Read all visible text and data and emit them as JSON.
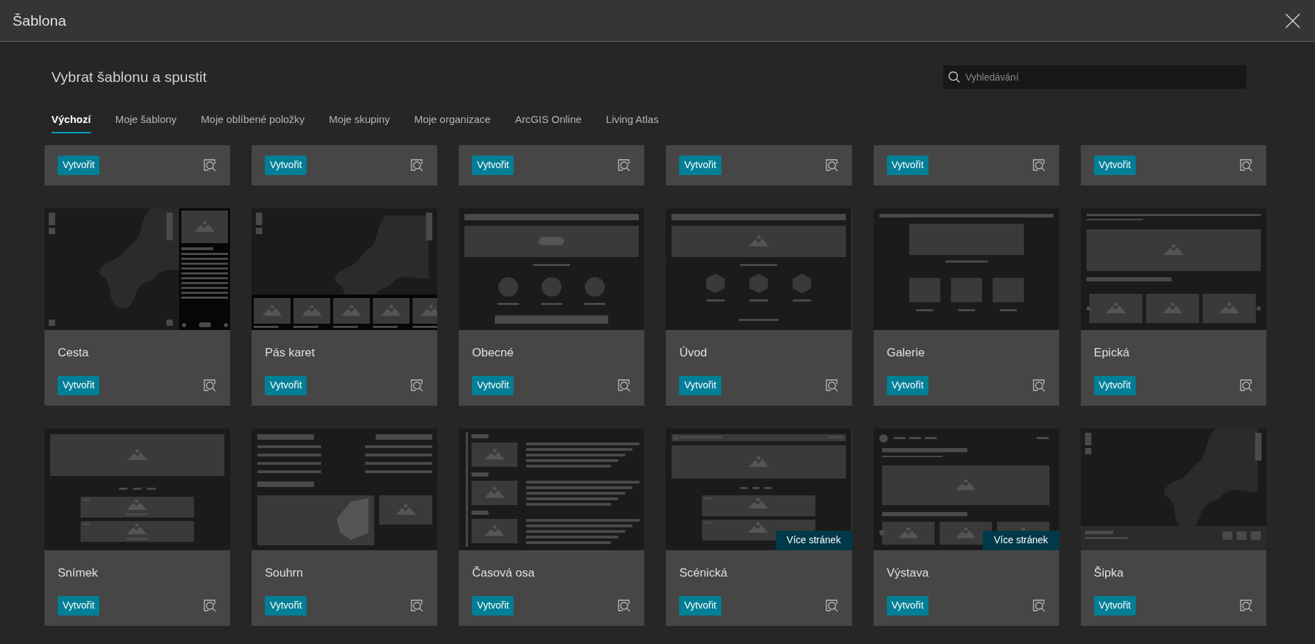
{
  "window": {
    "title": "Šablona"
  },
  "heading": "Vybrat šablonu a spustit",
  "search": {
    "placeholder": "Vyhledávání"
  },
  "tabs": [
    {
      "label": "Výchozí",
      "selected": true
    },
    {
      "label": "Moje šablony",
      "selected": false
    },
    {
      "label": "Moje oblíbené položky",
      "selected": false
    },
    {
      "label": "Moje skupiny",
      "selected": false
    },
    {
      "label": "Moje organizace",
      "selected": false
    },
    {
      "label": "ArcGIS Online",
      "selected": false
    },
    {
      "label": "Living Atlas",
      "selected": false
    }
  ],
  "partial_cards": [
    {
      "button": "Vytvořit"
    },
    {
      "button": "Vytvořit"
    },
    {
      "button": "Vytvořit"
    },
    {
      "button": "Vytvořit"
    },
    {
      "button": "Vytvořit"
    },
    {
      "button": "Vytvořit"
    }
  ],
  "cards": [
    {
      "title": "Cesta",
      "button": "Vytvořit"
    },
    {
      "title": "Pás karet",
      "button": "Vytvořit"
    },
    {
      "title": "Obecné",
      "button": "Vytvořit"
    },
    {
      "title": "Úvod",
      "button": "Vytvořit"
    },
    {
      "title": "Galerie",
      "button": "Vytvořit"
    },
    {
      "title": "Epická",
      "button": "Vytvořit"
    },
    {
      "title": "Snímek",
      "button": "Vytvořit"
    },
    {
      "title": "Souhrn",
      "button": "Vytvořit"
    },
    {
      "title": "Časová osa",
      "button": "Vytvořit"
    },
    {
      "title": "Scénická",
      "button": "Vytvořit",
      "badge": "Více stránek"
    },
    {
      "title": "Výstava",
      "button": "Vytvořit",
      "badge": "Více stránek"
    },
    {
      "title": "Šipka",
      "button": "Vytvořit"
    }
  ]
}
